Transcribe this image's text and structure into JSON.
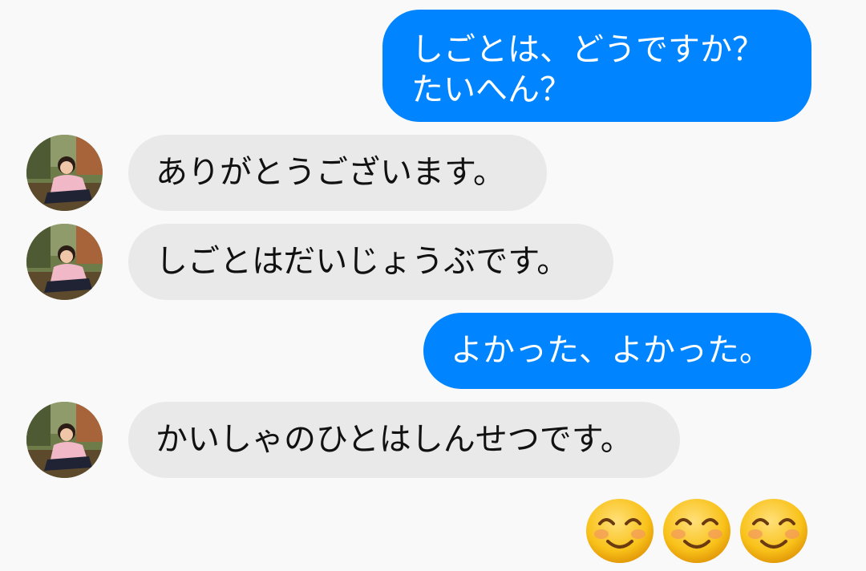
{
  "messages": [
    {
      "direction": "outgoing",
      "text": "しごとは、どうですか？\nたいへん？"
    },
    {
      "direction": "incoming",
      "text": "ありがとうございます。"
    },
    {
      "direction": "incoming",
      "text": "しごとはだいじょうぶです。"
    },
    {
      "direction": "outgoing",
      "text": "よかった、よかった。"
    },
    {
      "direction": "incoming",
      "text": "かいしゃのひとはしんせつです。"
    }
  ],
  "reactions": {
    "emoji_name": "smiling-face-with-smiling-eyes",
    "count": 3
  },
  "colors": {
    "outgoing_bubble": "#0084ff",
    "incoming_bubble": "#e9e9e9",
    "background": "#f9f9f9"
  }
}
